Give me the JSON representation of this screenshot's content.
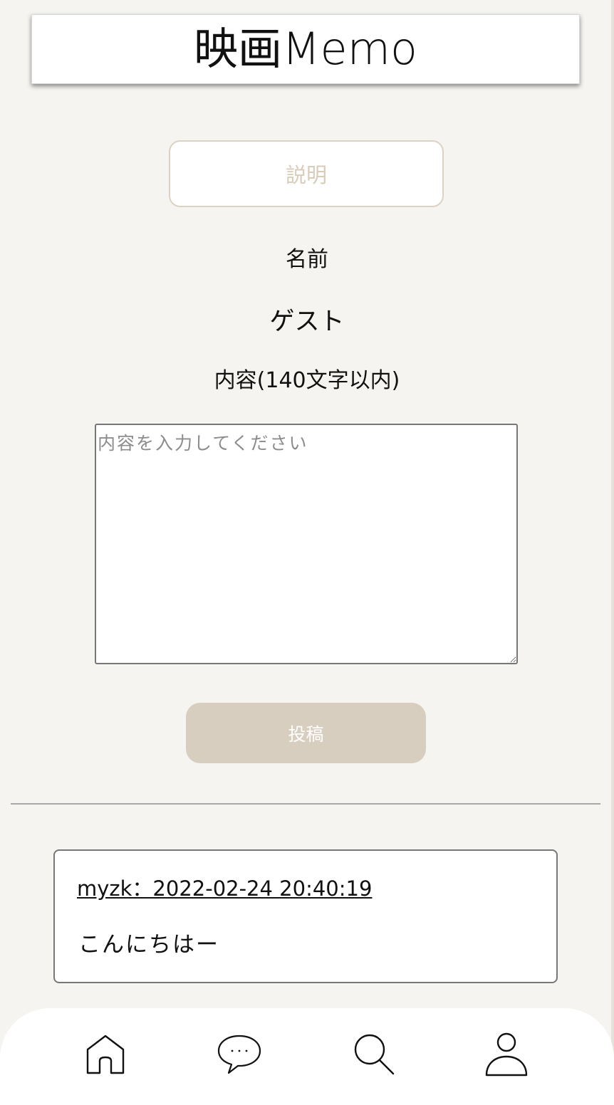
{
  "header": {
    "title": "映画Memo"
  },
  "description_button": {
    "label": "説明"
  },
  "form": {
    "name_label": "名前",
    "name_value": "ゲスト",
    "content_label": "内容(140文字以内)",
    "content_placeholder": "内容を入力してください",
    "content_value": "",
    "submit_label": "投稿"
  },
  "posts": [
    {
      "meta": "myzk：2022-02-24 20:40:19",
      "body": "こんにちはー"
    }
  ],
  "bottom_nav": {
    "items": [
      {
        "icon": "home-icon"
      },
      {
        "icon": "chat-bubble-icon"
      },
      {
        "icon": "search-icon"
      },
      {
        "icon": "user-icon"
      }
    ]
  }
}
